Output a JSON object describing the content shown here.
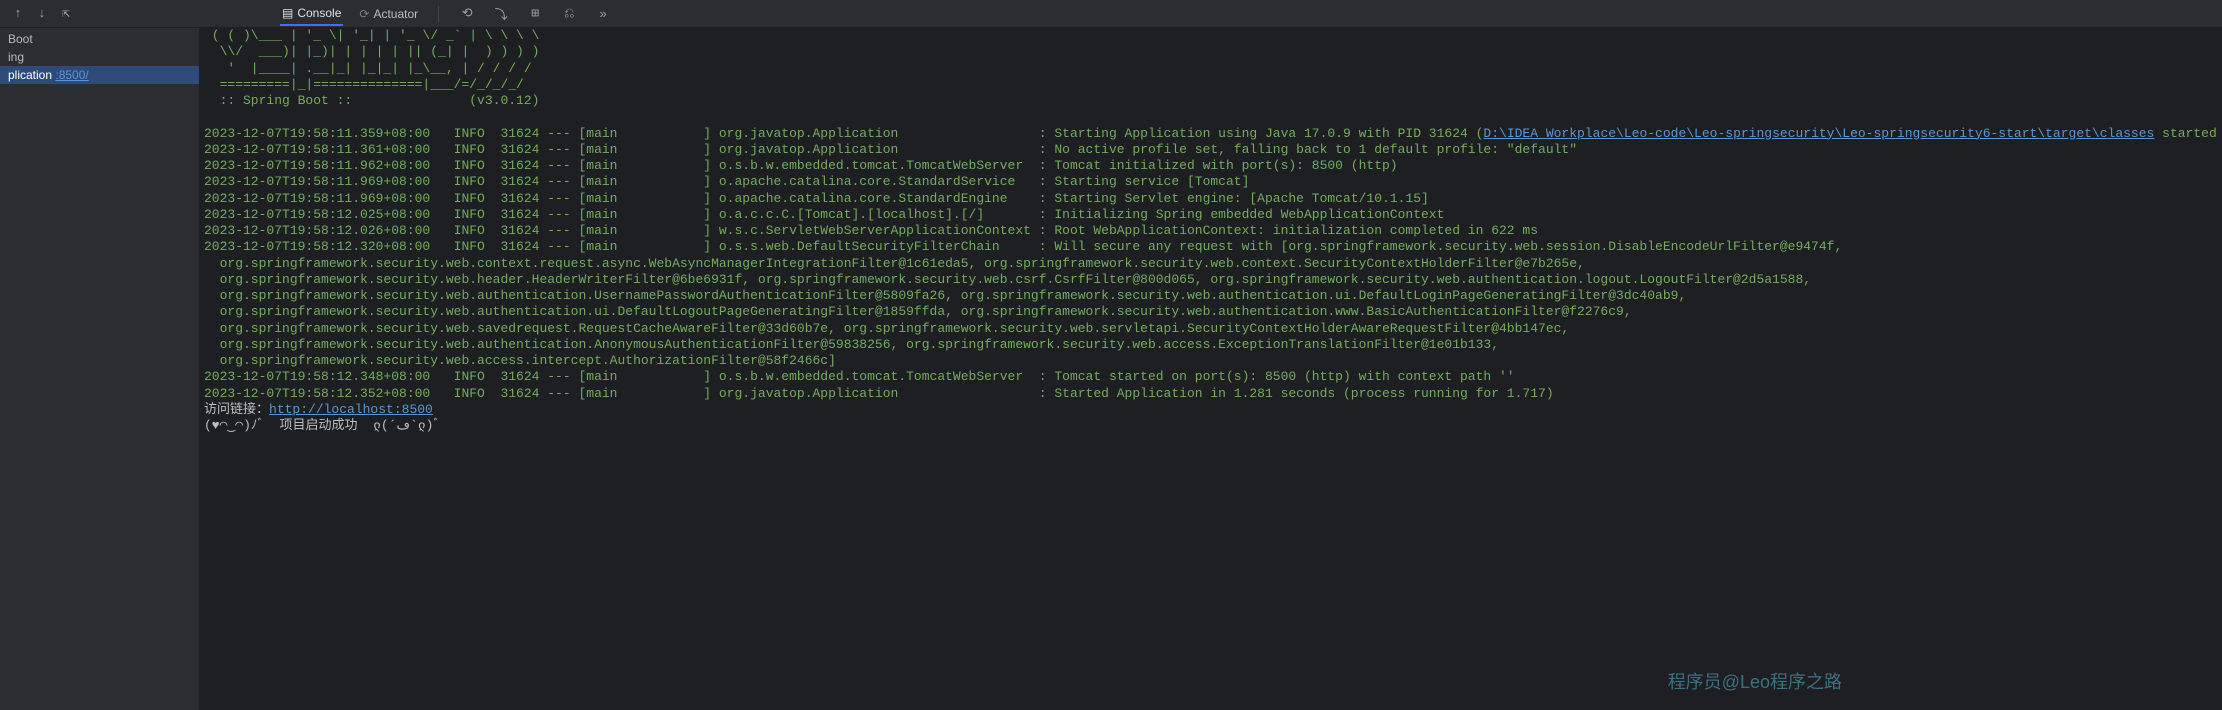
{
  "tabs": {
    "console": "Console",
    "actuator": "Actuator"
  },
  "sidebar": {
    "items": [
      {
        "label": " Boot"
      },
      {
        "label": "ing"
      },
      {
        "label": "plication "
      }
    ],
    "port_link": ":8500/"
  },
  "banner_lines": [
    " ( ( )\\___ | '_ \\| '_| | '_ \\/ _` | \\ \\ \\ \\",
    "  \\\\/  ___)| |_)| | | | | || (_| |  ) ) ) )",
    "   '  |____| .__|_| |_|_| |_\\__, | / / / /",
    "  =========|_|==============|___/=/_/_/_/",
    "  :: Spring Boot ::               (v3.0.12)"
  ],
  "log_entries": [
    {
      "ts": "2023-12-07T19:58:11.359+08:00",
      "level": "INFO",
      "pid": "31624",
      "thread": "main",
      "logger": "org.javatop.Application",
      "msg_prefix": "Starting Application using Java 17.0.9 with PID 31624 (",
      "link": "D:\\IDEA Workplace\\Leo-code\\Leo-springsecurity\\Leo-springsecurity6-start\\target\\classes",
      "msg_suffix": " started by Administrator in D:\\IDEA Workplace\\Leo-code\\Leo-springsecurity)"
    },
    {
      "ts": "2023-12-07T19:58:11.361+08:00",
      "level": "INFO",
      "pid": "31624",
      "thread": "main",
      "logger": "org.javatop.Application",
      "msg": "No active profile set, falling back to 1 default profile: \"default\""
    },
    {
      "ts": "2023-12-07T19:58:11.962+08:00",
      "level": "INFO",
      "pid": "31624",
      "thread": "main",
      "logger": "o.s.b.w.embedded.tomcat.TomcatWebServer",
      "msg": "Tomcat initialized with port(s): 8500 (http)"
    },
    {
      "ts": "2023-12-07T19:58:11.969+08:00",
      "level": "INFO",
      "pid": "31624",
      "thread": "main",
      "logger": "o.apache.catalina.core.StandardService",
      "msg": "Starting service [Tomcat]"
    },
    {
      "ts": "2023-12-07T19:58:11.969+08:00",
      "level": "INFO",
      "pid": "31624",
      "thread": "main",
      "logger": "o.apache.catalina.core.StandardEngine",
      "msg": "Starting Servlet engine: [Apache Tomcat/10.1.15]"
    },
    {
      "ts": "2023-12-07T19:58:12.025+08:00",
      "level": "INFO",
      "pid": "31624",
      "thread": "main",
      "logger": "o.a.c.c.C.[Tomcat].[localhost].[/]",
      "msg": "Initializing Spring embedded WebApplicationContext"
    },
    {
      "ts": "2023-12-07T19:58:12.026+08:00",
      "level": "INFO",
      "pid": "31624",
      "thread": "main",
      "logger": "w.s.c.ServletWebServerApplicationContext",
      "msg": "Root WebApplicationContext: initialization completed in 622 ms"
    },
    {
      "ts": "2023-12-07T19:58:12.320+08:00",
      "level": "INFO",
      "pid": "31624",
      "thread": "main",
      "logger": "o.s.s.web.DefaultSecurityFilterChain",
      "msg": "Will secure any request with [org.springframework.security.web.session.DisableEncodeUrlFilter@e9474f, org.springframework.security.web.context.request.async.WebAsyncManagerIntegrationFilter@1c61eda5, org.springframework.security.web.context.SecurityContextHolderFilter@e7b265e, org.springframework.security.web.header.HeaderWriterFilter@6be6931f, org.springframework.security.web.csrf.CsrfFilter@800d065, org.springframework.security.web.authentication.logout.LogoutFilter@2d5a1588, org.springframework.security.web.authentication.UsernamePasswordAuthenticationFilter@5809fa26, org.springframework.security.web.authentication.ui.DefaultLoginPageGeneratingFilter@3dc40ab9, org.springframework.security.web.authentication.ui.DefaultLogoutPageGeneratingFilter@1859ffda, org.springframework.security.web.authentication.www.BasicAuthenticationFilter@f2276c9, org.springframework.security.web.savedrequest.RequestCacheAwareFilter@33d60b7e, org.springframework.security.web.servletapi.SecurityContextHolderAwareRequestFilter@4bb147ec, org.springframework.security.web.authentication.AnonymousAuthenticationFilter@59838256, org.springframework.security.web.access.ExceptionTranslationFilter@1e01b133, org.springframework.security.web.access.intercept.AuthorizationFilter@58f2466c]"
    },
    {
      "ts": "2023-12-07T19:58:12.348+08:00",
      "level": "INFO",
      "pid": "31624",
      "thread": "main",
      "logger": "o.s.b.w.embedded.tomcat.TomcatWebServer",
      "msg": "Tomcat started on port(s): 8500 (http) with context path ''"
    },
    {
      "ts": "2023-12-07T19:58:12.352+08:00",
      "level": "INFO",
      "pid": "31624",
      "thread": "main",
      "logger": "org.javatop.Application",
      "msg": "Started Application in 1.281 seconds (process running for 1.717)"
    }
  ],
  "footer": {
    "visit_prefix": "访问链接：",
    "visit_link": "http://localhost:8500",
    "success_line": "(♥◠‿◠)ﾉﾞ  项目启动成功  ლ(´ڡ`ლ)ﾞ"
  },
  "watermark": "程序员@Leo程序之路"
}
